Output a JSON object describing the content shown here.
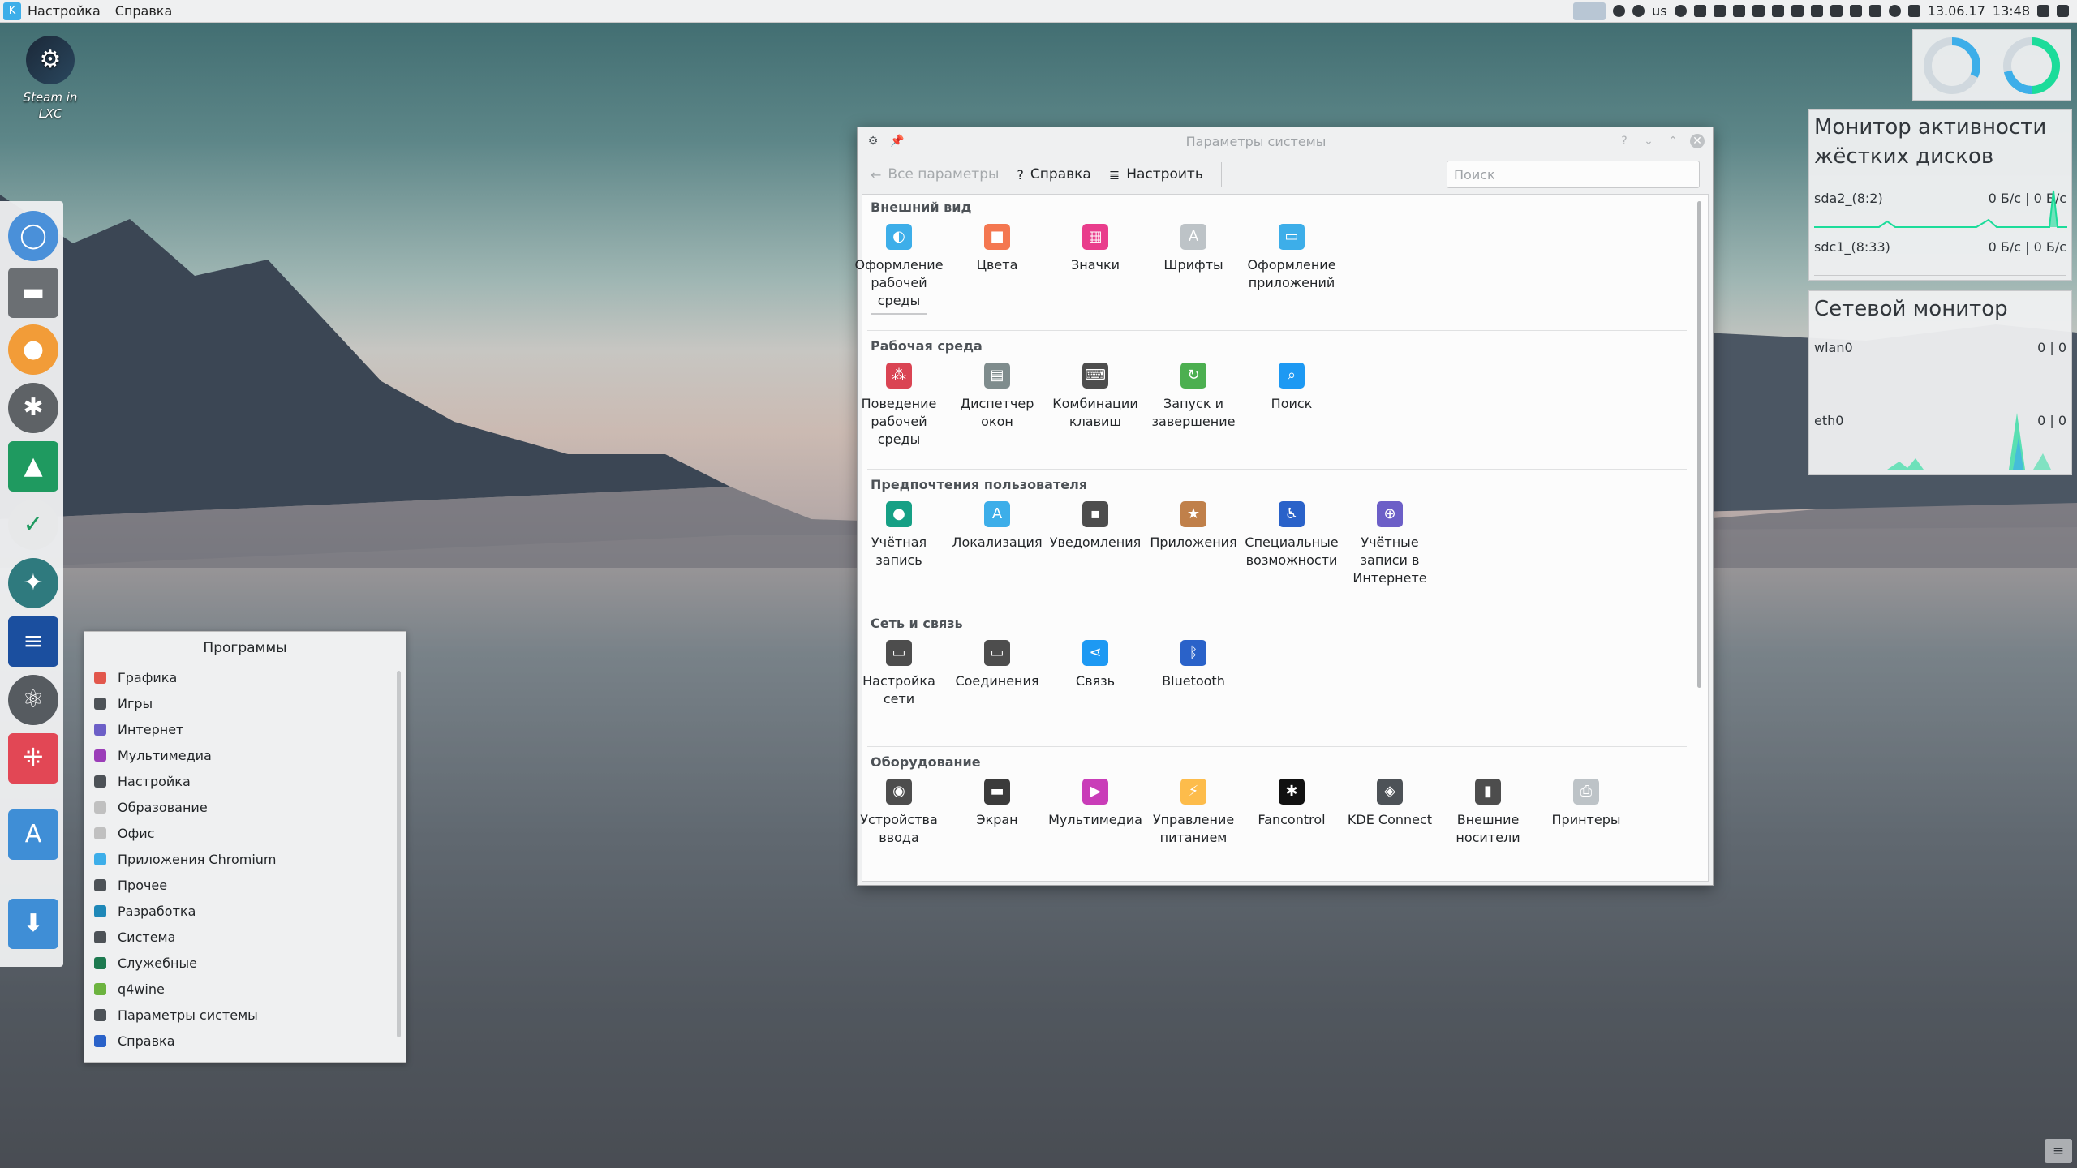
{
  "topbar": {
    "menu_settings": "Настройка",
    "menu_help": "Справка",
    "layout": "us",
    "date": "13.06.17",
    "time": "13:48"
  },
  "desktop": {
    "steam_label": "Steam in LXC"
  },
  "app_menu": {
    "title": "Программы",
    "items": [
      {
        "label": "Графика",
        "color": "#e2574c"
      },
      {
        "label": "Игры",
        "color": "#4d5257"
      },
      {
        "label": "Интернет",
        "color": "#6c5fc7"
      },
      {
        "label": "Мультимедиа",
        "color": "#9b3db8"
      },
      {
        "label": "Настройка",
        "color": "#4d5257"
      },
      {
        "label": "Образование",
        "color": "#c0c0c0"
      },
      {
        "label": "Офис",
        "color": "#c0c0c0"
      },
      {
        "label": "Приложения Chromium",
        "color": "#3daee9"
      },
      {
        "label": "Прочее",
        "color": "#4d5257"
      },
      {
        "label": "Разработка",
        "color": "#1e88b8"
      },
      {
        "label": "Система",
        "color": "#4d5257"
      },
      {
        "label": "Служебные",
        "color": "#1d7a50"
      },
      {
        "label": "q4wine",
        "color": "#6cb33f"
      },
      {
        "label": "Параметры системы",
        "color": "#4d5257"
      },
      {
        "label": "Справка",
        "color": "#2a62c9"
      }
    ]
  },
  "settings": {
    "title": "Параметры системы",
    "back_label": "Все параметры",
    "help_label": "Справка",
    "configure_label": "Настроить",
    "search_placeholder": "Поиск",
    "sections": [
      {
        "title": "Внешний вид",
        "modules": [
          {
            "label": "Оформление рабочей среды",
            "icon": "workspace-theme-icon",
            "color": "#3daee9"
          },
          {
            "label": "Цвета",
            "icon": "colors-icon",
            "color": "#f47750"
          },
          {
            "label": "Значки",
            "icon": "icons-icon",
            "color": "#e93d8c"
          },
          {
            "label": "Шрифты",
            "icon": "fonts-icon",
            "color": "#bdc3c7"
          },
          {
            "label": "Оформление приложений",
            "icon": "app-style-icon",
            "color": "#3daee9"
          }
        ]
      },
      {
        "title": "Рабочая среда",
        "modules": [
          {
            "label": "Поведение рабочей среды",
            "icon": "desktop-behavior-icon",
            "color": "#da4453"
          },
          {
            "label": "Диспетчер окон",
            "icon": "window-manager-icon",
            "color": "#7f8c8d"
          },
          {
            "label": "Комбинации клавиш",
            "icon": "shortcuts-icon",
            "color": "#4d4d4d"
          },
          {
            "label": "Запуск и завершение",
            "icon": "startup-icon",
            "color": "#4caf50"
          },
          {
            "label": "Поиск",
            "icon": "search-icon",
            "color": "#1d99f3"
          }
        ]
      },
      {
        "title": "Предпочтения пользователя",
        "modules": [
          {
            "label": "Учётная запись",
            "icon": "account-icon",
            "color": "#16a085"
          },
          {
            "label": "Локализация",
            "icon": "localization-icon",
            "color": "#3daee9"
          },
          {
            "label": "Уведомления",
            "icon": "notifications-icon",
            "color": "#4d4d4d"
          },
          {
            "label": "Приложения",
            "icon": "applications-icon",
            "color": "#c0804a"
          },
          {
            "label": "Специальные возможности",
            "icon": "accessibility-icon",
            "color": "#2a62c9"
          },
          {
            "label": "Учётные записи в Интернете",
            "icon": "online-accounts-icon",
            "color": "#6c5fc7"
          }
        ]
      },
      {
        "title": "Сеть и связь",
        "modules": [
          {
            "label": "Настройка сети",
            "icon": "network-settings-icon",
            "color": "#4d4d4d"
          },
          {
            "label": "Соединения",
            "icon": "connections-icon",
            "color": "#4d4d4d"
          },
          {
            "label": "Связь",
            "icon": "share-icon",
            "color": "#1d99f3"
          },
          {
            "label": "Bluetooth",
            "icon": "bluetooth-icon",
            "color": "#2a62c9"
          }
        ]
      },
      {
        "title": "Оборудование",
        "modules": [
          {
            "label": "Устройства ввода",
            "icon": "input-devices-icon",
            "color": "#4d4d4d"
          },
          {
            "label": "Экран",
            "icon": "display-icon",
            "color": "#3b3b3b"
          },
          {
            "label": "Мультимедиа",
            "icon": "multimedia-icon",
            "color": "#c93db8"
          },
          {
            "label": "Управление питанием",
            "icon": "power-icon",
            "color": "#fdbc4b"
          },
          {
            "label": "Fancontrol",
            "icon": "fan-icon",
            "color": "#111111"
          },
          {
            "label": "KDE Connect",
            "icon": "kde-connect-icon",
            "color": "#4d5257"
          },
          {
            "label": "Внешние носители",
            "icon": "removable-media-icon",
            "color": "#4d4d4d"
          },
          {
            "label": "Принтеры",
            "icon": "printer-icon",
            "color": "#bdc3c7"
          }
        ]
      }
    ]
  },
  "disk_monitor": {
    "title": "Монитор активности жёстких дисков",
    "rows": [
      {
        "name": "sda2_(8:2)",
        "value": "0 Б/с | 0 Б/с"
      },
      {
        "name": "sdc1_(8:33)",
        "value": "0 Б/с | 0 Б/с"
      }
    ]
  },
  "net_monitor": {
    "title": "Сетевой монитор",
    "rows": [
      {
        "name": "wlan0",
        "value": "0 | 0"
      },
      {
        "name": "eth0",
        "value": "0 | 0"
      }
    ]
  }
}
